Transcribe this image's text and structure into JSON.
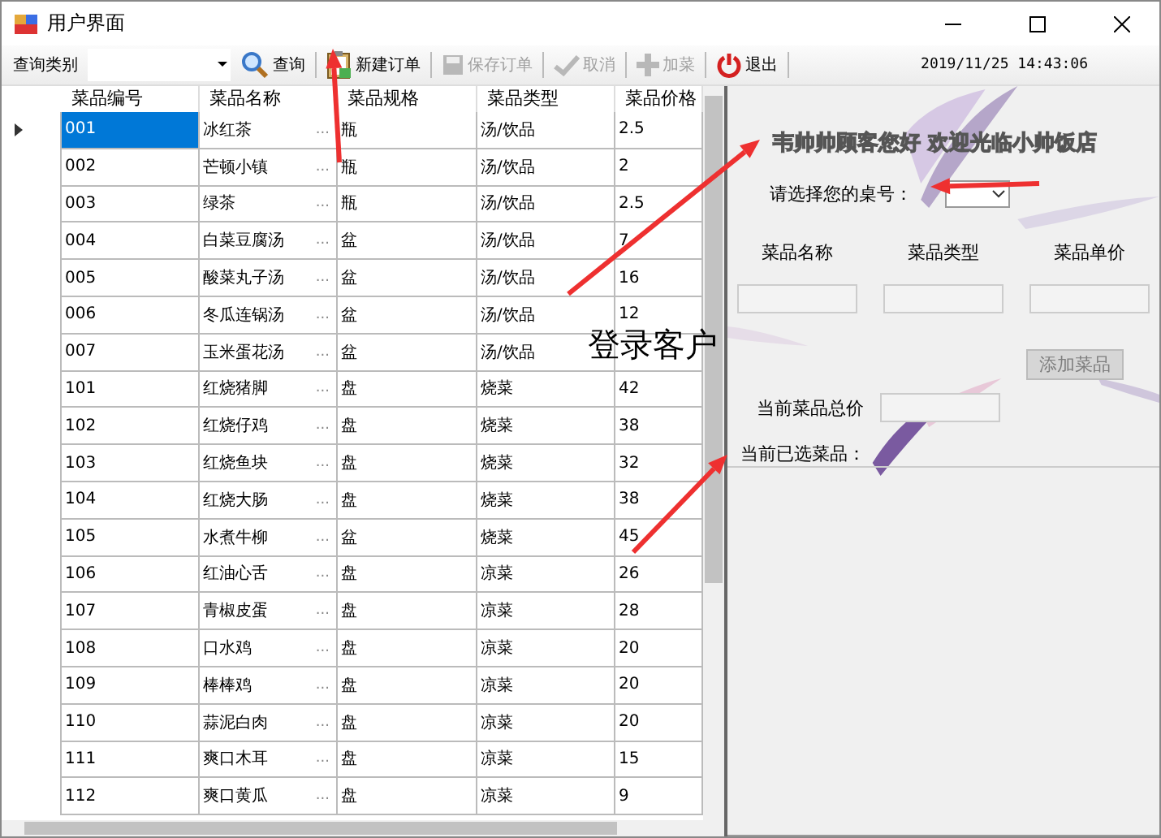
{
  "window": {
    "title": "用户界面"
  },
  "toolbar": {
    "query_label": "查询类别",
    "query_button": "查询",
    "items": [
      {
        "label": "新建订单",
        "kind": "new",
        "disabled": false
      },
      {
        "label": "保存订单",
        "kind": "save",
        "disabled": true
      },
      {
        "label": "取消",
        "kind": "cancel",
        "disabled": true
      },
      {
        "label": "加菜",
        "kind": "add",
        "disabled": true
      },
      {
        "label": "退出",
        "kind": "exit",
        "disabled": false
      }
    ],
    "datetime": "2019/11/25 14:43:06"
  },
  "table": {
    "columns": [
      "菜品编号",
      "菜品名称",
      "菜品规格",
      "菜品类型",
      "菜品价格"
    ],
    "rows": [
      {
        "id": "001",
        "name": "冰红茶",
        "name_button": "...",
        "spec": "瓶",
        "type": "汤/饮品",
        "price": "2.5",
        "selected": true
      },
      {
        "id": "002",
        "name": "芒顿小镇",
        "name_button": "...",
        "spec": "瓶",
        "type": "汤/饮品",
        "price": "2",
        "selected": false
      },
      {
        "id": "003",
        "name": "绿茶",
        "name_button": "...",
        "spec": "瓶",
        "type": "汤/饮品",
        "price": "2.5",
        "selected": false
      },
      {
        "id": "004",
        "name": "白菜豆腐汤",
        "name_button": "...",
        "spec": "盆",
        "type": "汤/饮品",
        "price": "7",
        "selected": false
      },
      {
        "id": "005",
        "name": "酸菜丸子汤",
        "name_button": "...",
        "spec": "盆",
        "type": "汤/饮品",
        "price": "16",
        "selected": false
      },
      {
        "id": "006",
        "name": "冬瓜连锅汤",
        "name_button": "...",
        "spec": "盆",
        "type": "汤/饮品",
        "price": "12",
        "selected": false
      },
      {
        "id": "007",
        "name": "玉米蛋花汤",
        "name_button": "...",
        "spec": "盆",
        "type": "汤/饮品",
        "price": "",
        "selected": false
      },
      {
        "id": "101",
        "name": "红烧猪脚",
        "name_button": "...",
        "spec": "盘",
        "type": "烧菜",
        "price": "42",
        "selected": false
      },
      {
        "id": "102",
        "name": "红烧仔鸡",
        "name_button": "...",
        "spec": "盘",
        "type": "烧菜",
        "price": "38",
        "selected": false
      },
      {
        "id": "103",
        "name": "红烧鱼块",
        "name_button": "...",
        "spec": "盘",
        "type": "烧菜",
        "price": "32",
        "selected": false
      },
      {
        "id": "104",
        "name": "红烧大肠",
        "name_button": "...",
        "spec": "盘",
        "type": "烧菜",
        "price": "38",
        "selected": false
      },
      {
        "id": "105",
        "name": "水煮牛柳",
        "name_button": "...",
        "spec": "盆",
        "type": "烧菜",
        "price": "45",
        "selected": false
      },
      {
        "id": "106",
        "name": "红油心舌",
        "name_button": "...",
        "spec": "盘",
        "type": "凉菜",
        "price": "26",
        "selected": false
      },
      {
        "id": "107",
        "name": "青椒皮蛋",
        "name_button": "...",
        "spec": "盘",
        "type": "凉菜",
        "price": "28",
        "selected": false
      },
      {
        "id": "108",
        "name": "口水鸡",
        "name_button": "...",
        "spec": "盘",
        "type": "凉菜",
        "price": "20",
        "selected": false
      },
      {
        "id": "109",
        "name": "棒棒鸡",
        "name_button": "...",
        "spec": "盘",
        "type": "凉菜",
        "price": "20",
        "selected": false
      },
      {
        "id": "110",
        "name": "蒜泥白肉",
        "name_button": "...",
        "spec": "盘",
        "type": "凉菜",
        "price": "20",
        "selected": false
      },
      {
        "id": "111",
        "name": "爽口木耳",
        "name_button": "...",
        "spec": "盘",
        "type": "凉菜",
        "price": "15",
        "selected": false
      },
      {
        "id": "112",
        "name": "爽口黄瓜",
        "name_button": "...",
        "spec": "盘",
        "type": "凉菜",
        "price": "9",
        "selected": false
      }
    ]
  },
  "order_panel": {
    "greeting": "韦帅帅顾客您好 欢迎光临小帅饭店",
    "table_label": "请选择您的桌号：",
    "field_labels": [
      "菜品名称",
      "菜品类型",
      "菜品单价"
    ],
    "add_button": {
      "label": "添加菜品",
      "disabled": true
    },
    "total_label": "当前菜品总价",
    "selected_label": "当前已选菜品："
  },
  "annotation": "登录客户"
}
